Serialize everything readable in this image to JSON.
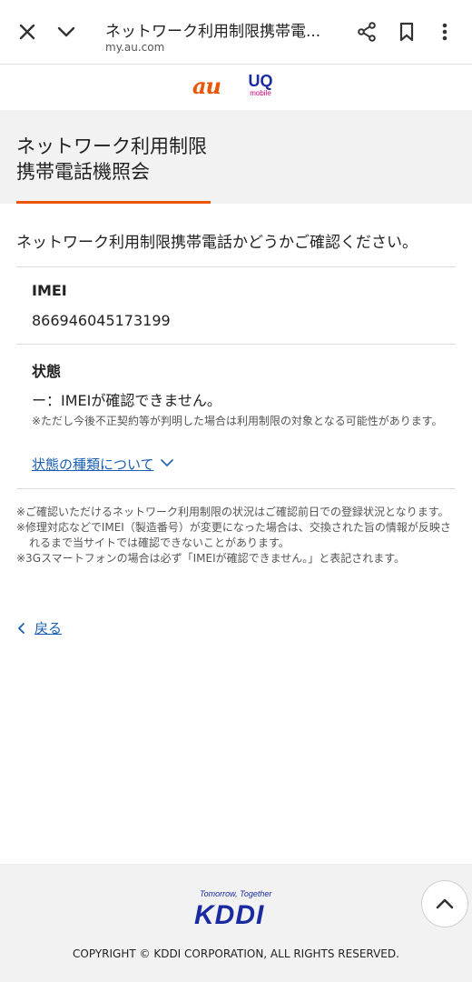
{
  "browser": {
    "title": "ネットワーク利用制限携帯電...",
    "url": "my.au.com",
    "close_icon": "close-icon",
    "collapse_icon": "chevron-down-icon",
    "share_icon": "share-icon",
    "bookmark_icon": "bookmark-icon",
    "menu_icon": "more-vert-icon"
  },
  "brand": {
    "au": "au",
    "uq": "UQ",
    "uq_sub": "mobile"
  },
  "page": {
    "title_line1": "ネットワーク利用制限",
    "title_line2": "携帯電話機照会",
    "intro": "ネットワーク利用制限携帯電話かどうかご確認ください。",
    "imei_label": "IMEI",
    "imei_value": "866946045173199",
    "status_label": "状態",
    "status_value": "ー：IMEIが確認できません。",
    "status_note": "※ただし今後不正契約等が判明した場合は利用制限の対象となる可能性があります。",
    "status_link": "状態の種類について",
    "footnotes": [
      "※ご確認いただけるネットワーク利用制限の状況はご確認前日での登録状況となります。",
      "※修理対応などでIMEI（製造番号）が変更になった場合は、交換された旨の情報が反映されるまで当サイトでは確認できないことがあります。",
      "※3Gスマートフォンの場合は必ず「IMEIが確認できません。」と表記されます。"
    ],
    "back_label": "戻る"
  },
  "footer": {
    "tagline": "Tomorrow, Together",
    "logo": "KDDI",
    "copyright": "COPYRIGHT © KDDI CORPORATION, ALL RIGHTS RESERVED."
  },
  "colors": {
    "accent": "#eb5505",
    "link": "#1a5fb4",
    "kddi_blue": "#1a2aa0"
  }
}
